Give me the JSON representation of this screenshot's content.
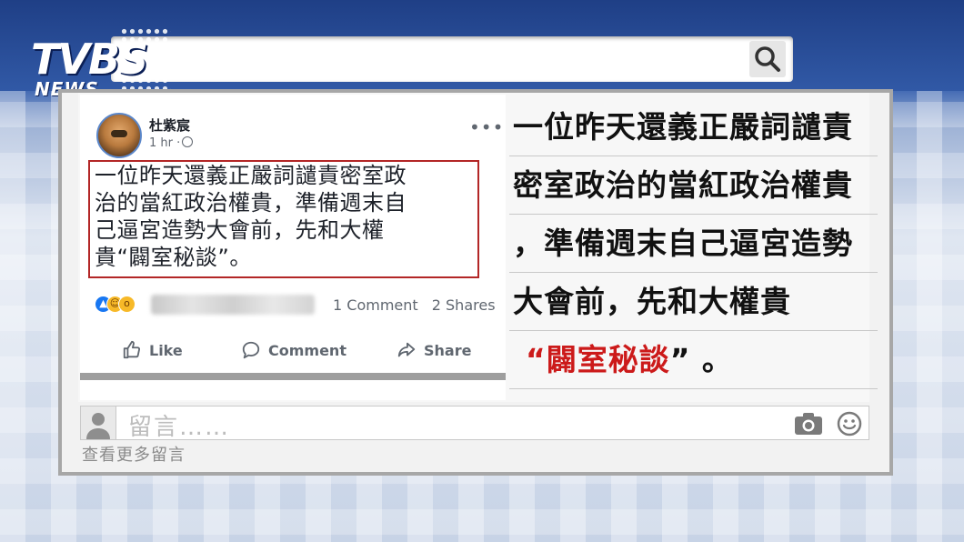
{
  "logo": {
    "brand": "TVBS",
    "sub": "NEWS"
  },
  "post": {
    "author": "杜紫宸",
    "time": "1 hr ·",
    "more": "•••",
    "text_lines": [
      "一位昨天還義正嚴詞譴責密室政",
      "治的當紅政治權貴，準備週末自",
      "己逼宮造勢大會前，先和大權",
      "貴“闢室秘談”。"
    ],
    "comments": "1 Comment",
    "shares": "2 Shares",
    "actions": {
      "like": "Like",
      "comment": "Comment",
      "share": "Share"
    },
    "reactions": [
      "like-icon",
      "haha-icon",
      "wow-icon"
    ]
  },
  "quote": {
    "line1": "一位昨天還義正嚴詞譴責",
    "line2": "密室政治的當紅政治權貴",
    "line3": "，準備週末自己逼宮造勢",
    "line4": "大會前，先和大權貴",
    "line5_open": "“",
    "line5_red": "闢室秘談",
    "line5_close": "” 。"
  },
  "comment_box": {
    "placeholder": "留言……"
  },
  "view_more": "查看更多留言",
  "colors": {
    "accent_red": "#cc1a1a",
    "facebook_blue": "#1877f2",
    "band_blue": "#2a4f9a"
  }
}
